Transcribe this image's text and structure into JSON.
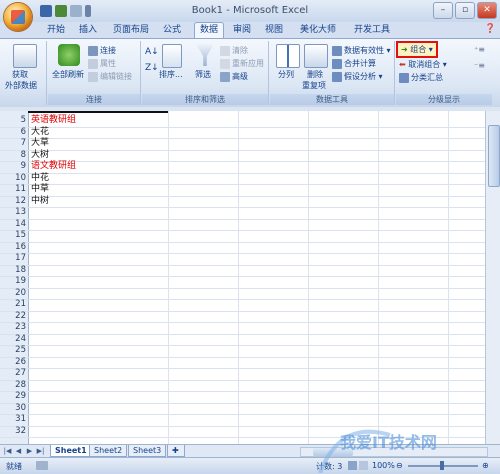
{
  "window": {
    "title": "Book1 - Microsoft Excel",
    "min": "–",
    "max": "▫",
    "close": "✕"
  },
  "tabs": [
    "开始",
    "插入",
    "页面布局",
    "公式",
    "数据",
    "审阅",
    "视图",
    "美化大师",
    "开发工具"
  ],
  "active_tab": "数据",
  "ribbon": {
    "get_external": {
      "line1": "获取",
      "line2": "外部数据"
    },
    "refresh_all": "全部刷新",
    "connections": "连接",
    "properties": "属性",
    "edit_links": "编辑链接",
    "group_connections": "连接",
    "sort": "排序...",
    "filter": "筛选",
    "clear": "清除",
    "reapply": "重新应用",
    "advanced": "高级",
    "group_sort_filter": "排序和筛选",
    "text_to_columns": "分列",
    "remove_dup": {
      "line1": "删除",
      "line2": "重复项"
    },
    "data_validation": "数据有效性",
    "consolidate": "合并计算",
    "what_if": "假设分析",
    "group_data_tools": "数据工具",
    "group_btn": "组合",
    "ungroup_btn": "取消组合",
    "subtotal": "分类汇总",
    "group_outline": "分级显示"
  },
  "rows": [
    {
      "n": "5",
      "text": "英语教研组",
      "red": true
    },
    {
      "n": "6",
      "text": "大花"
    },
    {
      "n": "7",
      "text": "大草"
    },
    {
      "n": "8",
      "text": "大树"
    },
    {
      "n": "9",
      "text": "语文教研组",
      "red": true
    },
    {
      "n": "10",
      "text": "中花"
    },
    {
      "n": "11",
      "text": "中草"
    },
    {
      "n": "12",
      "text": "中树"
    },
    {
      "n": "13",
      "text": ""
    },
    {
      "n": "14",
      "text": ""
    },
    {
      "n": "15",
      "text": ""
    },
    {
      "n": "16",
      "text": ""
    },
    {
      "n": "17",
      "text": ""
    },
    {
      "n": "18",
      "text": ""
    },
    {
      "n": "19",
      "text": ""
    },
    {
      "n": "20",
      "text": ""
    },
    {
      "n": "21",
      "text": ""
    },
    {
      "n": "22",
      "text": ""
    },
    {
      "n": "23",
      "text": ""
    },
    {
      "n": "24",
      "text": ""
    },
    {
      "n": "25",
      "text": ""
    },
    {
      "n": "26",
      "text": ""
    },
    {
      "n": "27",
      "text": ""
    },
    {
      "n": "28",
      "text": ""
    },
    {
      "n": "29",
      "text": ""
    },
    {
      "n": "30",
      "text": ""
    },
    {
      "n": "31",
      "text": ""
    },
    {
      "n": "32",
      "text": ""
    }
  ],
  "sheets": [
    "Sheet1",
    "Sheet2",
    "Sheet3"
  ],
  "active_sheet": "Sheet1",
  "status": {
    "ready": "就绪",
    "count": "计数: 3",
    "zoom": "100%"
  },
  "watermark": "我爱IT技术网"
}
